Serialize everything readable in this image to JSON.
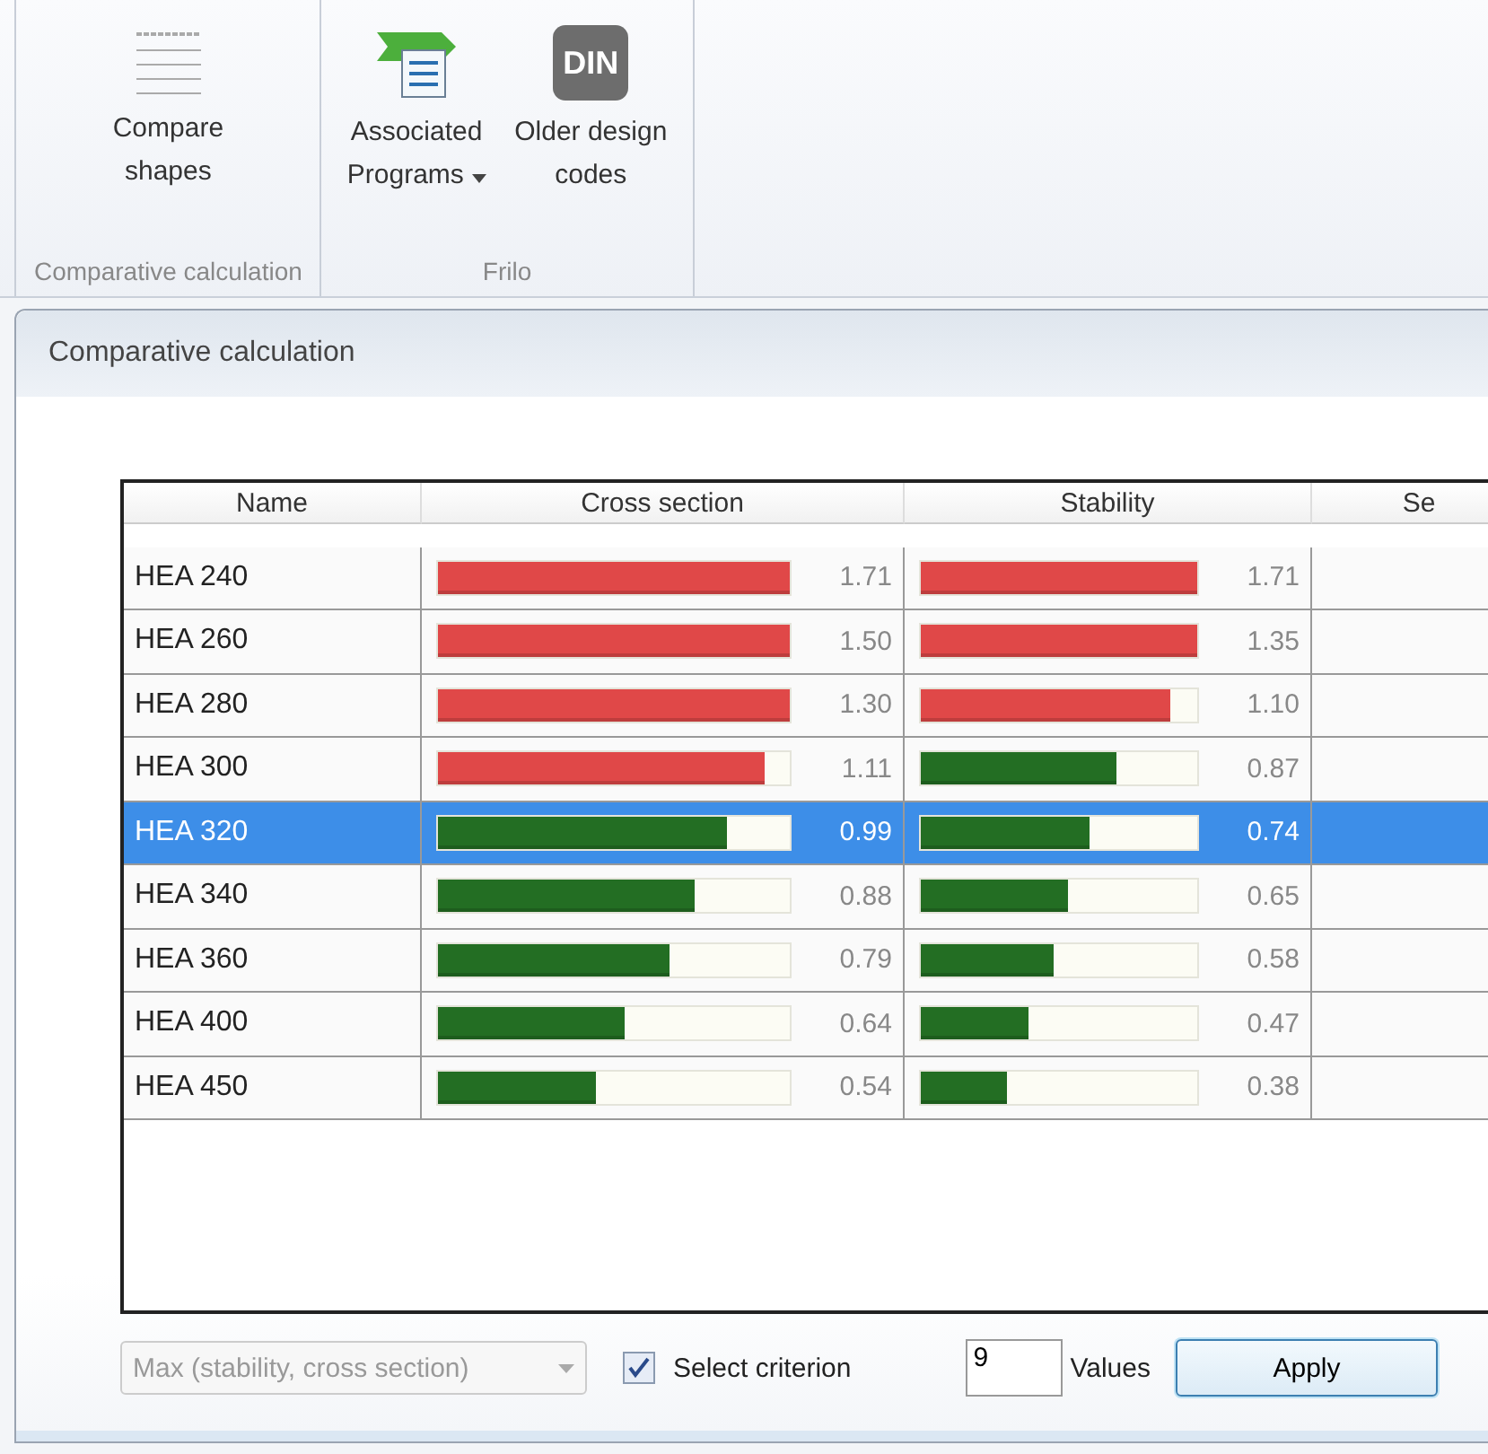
{
  "ribbon": {
    "groups": [
      {
        "label": "Comparative calculation",
        "buttons": [
          {
            "kind": "lines",
            "label": "Compare\nshapes",
            "dropdown": false
          }
        ]
      },
      {
        "label": "Frilo",
        "buttons": [
          {
            "kind": "programs",
            "label": "Associated\nPrograms",
            "dropdown": true
          },
          {
            "kind": "din",
            "label": "Older design\ncodes",
            "dropdown": false,
            "icon_text": "DIN"
          }
        ]
      }
    ]
  },
  "panel": {
    "title": "Comparative calculation",
    "table": {
      "columns": [
        "Name",
        "Cross section",
        "Stability",
        "Se"
      ],
      "rows": [
        {
          "name": "HEA 240",
          "selected": false,
          "cross_section": {
            "level": 1.0,
            "color": "#e04848",
            "reading": "1.71"
          },
          "stability": {
            "level": 1.0,
            "color": "#e04848",
            "reading": "1.71"
          }
        },
        {
          "name": "HEA 260",
          "selected": false,
          "cross_section": {
            "level": 1.0,
            "color": "#e04848",
            "reading": "1.50"
          },
          "stability": {
            "level": 1.0,
            "color": "#e04848",
            "reading": "1.35"
          }
        },
        {
          "name": "HEA 280",
          "selected": false,
          "cross_section": {
            "level": 1.0,
            "color": "#e04848",
            "reading": "1.30"
          },
          "stability": {
            "level": 0.9,
            "color": "#e04848",
            "reading": "1.10"
          }
        },
        {
          "name": "HEA 300",
          "selected": false,
          "cross_section": {
            "level": 0.93,
            "color": "#e04848",
            "reading": "1.11"
          },
          "stability": {
            "level": 0.71,
            "color": "#236e23",
            "reading": "0.87"
          }
        },
        {
          "name": "HEA 320",
          "selected": true,
          "cross_section": {
            "level": 0.82,
            "color": "#236e23",
            "reading": "0.99"
          },
          "stability": {
            "level": 0.61,
            "color": "#236e23",
            "reading": "0.74"
          }
        },
        {
          "name": "HEA 340",
          "selected": false,
          "cross_section": {
            "level": 0.73,
            "color": "#236e23",
            "reading": "0.88"
          },
          "stability": {
            "level": 0.53,
            "color": "#236e23",
            "reading": "0.65"
          }
        },
        {
          "name": "HEA 360",
          "selected": false,
          "cross_section": {
            "level": 0.66,
            "color": "#236e23",
            "reading": "0.79"
          },
          "stability": {
            "level": 0.48,
            "color": "#236e23",
            "reading": "0.58"
          }
        },
        {
          "name": "HEA 400",
          "selected": false,
          "cross_section": {
            "level": 0.53,
            "color": "#236e23",
            "reading": "0.64"
          },
          "stability": {
            "level": 0.39,
            "color": "#236e23",
            "reading": "0.47"
          }
        },
        {
          "name": "HEA 450",
          "selected": false,
          "cross_section": {
            "level": 0.45,
            "color": "#236e23",
            "reading": "0.54"
          },
          "stability": {
            "level": 0.31,
            "color": "#236e23",
            "reading": "0.38"
          }
        }
      ]
    },
    "criterion_dropdown": {
      "value": "Max (stability, cross section)",
      "disabled": true
    },
    "select_criterion": {
      "label": "Select criterion",
      "checked": true
    },
    "values_field": {
      "value": "9"
    },
    "values_label": "Values",
    "apply_button": "Apply"
  }
}
